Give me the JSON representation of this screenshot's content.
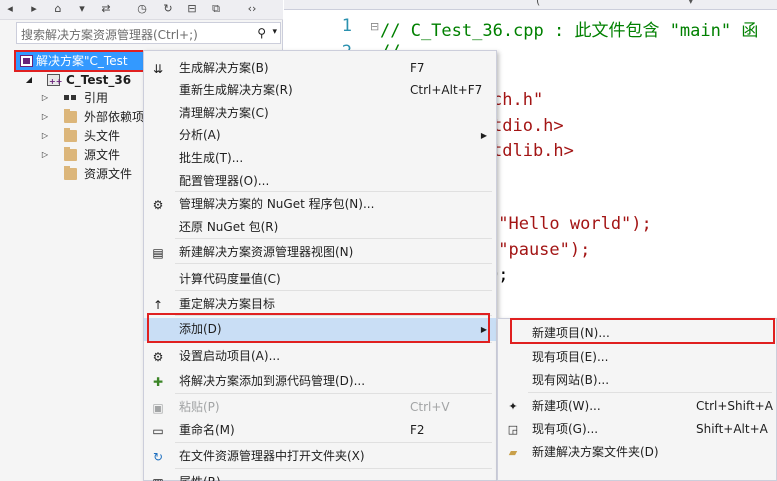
{
  "search": {
    "placeholder": "搜索解决方案资源管理器(Ctrl+;)"
  },
  "tree": {
    "solution_label": "解决方案\"C_Test",
    "project_label": "C_Test_36",
    "items": [
      "引用",
      "外部依赖项",
      "头文件",
      "源文件",
      "资源文件"
    ]
  },
  "editor": {
    "line_numbers": [
      "1",
      "2"
    ],
    "lines": [
      "// C_Test_36.cpp : 此文件包含 \"main\" 函",
      "//",
      "ch.h\"",
      "tdio.h>",
      "tdlib.h>",
      "(\"Hello world\");",
      "(\"pause\");",
      "0;"
    ]
  },
  "context_menu": {
    "items": [
      {
        "icon": "build-solution-icon",
        "label": "生成解决方案(B)",
        "shortcut": "F7"
      },
      {
        "icon": "",
        "label": "重新生成解决方案(R)",
        "shortcut": "Ctrl+Alt+F7"
      },
      {
        "icon": "",
        "label": "清理解决方案(C)",
        "shortcut": ""
      },
      {
        "icon": "",
        "label": "分析(A)",
        "shortcut": ""
      },
      {
        "icon": "",
        "label": "批生成(T)...",
        "shortcut": ""
      },
      {
        "icon": "",
        "label": "配置管理器(O)...",
        "shortcut": ""
      },
      {
        "icon": "nuget-package-icon",
        "label": "管理解决方案的 NuGet 程序包(N)...",
        "shortcut": ""
      },
      {
        "icon": "",
        "label": "还原 NuGet 包(R)",
        "shortcut": ""
      },
      {
        "icon": "new-view-icon",
        "label": "新建解决方案资源管理器视图(N)",
        "shortcut": ""
      },
      {
        "icon": "",
        "label": "计算代码度量值(C)",
        "shortcut": ""
      },
      {
        "icon": "retarget-icon",
        "label": "重定解决方案目标",
        "shortcut": ""
      },
      {
        "icon": "",
        "label": "添加(D)",
        "shortcut": ""
      },
      {
        "icon": "gear-icon",
        "label": "设置启动项目(A)...",
        "shortcut": ""
      },
      {
        "icon": "source-control-icon",
        "label": "将解决方案添加到源代码管理(D)...",
        "shortcut": ""
      },
      {
        "icon": "paste-icon",
        "label": "粘贴(P)",
        "shortcut": "Ctrl+V"
      },
      {
        "icon": "rename-icon",
        "label": "重命名(M)",
        "shortcut": "F2"
      },
      {
        "icon": "refresh-icon",
        "label": "在文件资源管理器中打开文件夹(X)",
        "shortcut": ""
      },
      {
        "icon": "properties-icon",
        "label": "属性(R)",
        "shortcut": ""
      }
    ]
  },
  "submenu": {
    "items": [
      {
        "icon": "",
        "label": "新建项目(N)...",
        "shortcut": ""
      },
      {
        "icon": "",
        "label": "现有项目(E)...",
        "shortcut": ""
      },
      {
        "icon": "",
        "label": "现有网站(B)...",
        "shortcut": ""
      },
      {
        "icon": "new-item-icon",
        "label": "新建项(W)...",
        "shortcut": "Ctrl+Shift+A"
      },
      {
        "icon": "existing-item-icon",
        "label": "现有项(G)...",
        "shortcut": "Shift+Alt+A"
      },
      {
        "icon": "new-solution-folder-icon",
        "label": "新建解决方案文件夹(D)",
        "shortcut": ""
      }
    ]
  },
  "colors": {
    "selection": "#3399ff",
    "highlight": "#c9def5",
    "annotation_red": "#e02020",
    "comment_green": "#008000",
    "string_red": "#a31515",
    "line_number_blue": "#2b91af"
  }
}
